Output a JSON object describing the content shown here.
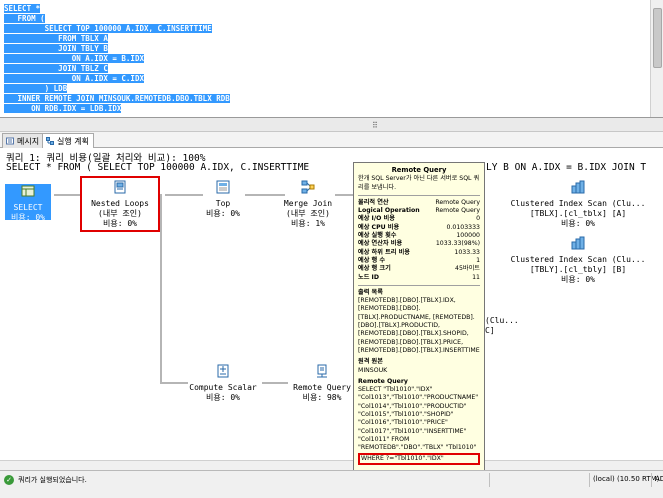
{
  "editor": {
    "lines": [
      "SELECT *",
      "   FROM (",
      "         SELECT TOP 100000 A.IDX, C.INSERTTIME",
      "            FROM TBLX A",
      "            JOIN TBLY B",
      "               ON A.IDX = B.IDX",
      "            JOIN TBLZ C",
      "               ON A.IDX = C.IDX",
      "         ) LDB",
      "   INNER REMOTE JOIN MINSOUK.REMOTEDB.DBO.TBLX RDB",
      "      ON RDB.IDX = LDB.IDX"
    ]
  },
  "splitter": {
    "grip": "⠿"
  },
  "tabs": [
    {
      "label": "메시지"
    },
    {
      "label": "실행 계획"
    }
  ],
  "plan": {
    "header_line1": "쿼리 1: 쿼리 비용(일괄 처리와 비교): 100%",
    "header_line2": "SELECT * FROM ( SELECT TOP 100000 A.IDX, C.INSERTTIME",
    "header_line2_tail": "LY B ON A.IDX = B.IDX JOIN T",
    "ops": {
      "select": {
        "name": "SELECT",
        "cost": "비용: 0%"
      },
      "nested": {
        "name": "Nested Loops",
        "sub": "(내부 조인)",
        "cost": "비용: 0%"
      },
      "top": {
        "name": "Top",
        "cost": "비용: 0%"
      },
      "merge": {
        "name": "Merge Join",
        "sub": "(내부 조인)",
        "cost": "비용: 1%"
      },
      "cis1": {
        "name": "Clustered Index Scan (Clu...",
        "obj": "[TBLX].[cl_tblx] [A]",
        "cost": "비용: 0%"
      },
      "cis2": {
        "name": "Clustered Index Scan (Clu...",
        "obj": "[TBLY].[cl_tbly] [B]",
        "cost": "비용: 0%"
      },
      "cis3_tail": "(Clu...",
      "cis3_tail2": "C]",
      "compute": {
        "name": "Compute Scalar",
        "cost": "비용: 0%"
      },
      "remote": {
        "name": "Remote Query",
        "cost": "비용: 98%"
      }
    }
  },
  "tooltip": {
    "title": "Remote Query",
    "desc": "한개 SQL Server가 아닌 다른 서버로 SQL 쿼리를 보냅니다.",
    "rows": [
      {
        "k": "물리적 연산",
        "v": "Remote Query",
        "bold": true
      },
      {
        "k": "Logical Operation",
        "v": "Remote Query",
        "bold": true
      },
      {
        "k": "예상 I/O 비용",
        "v": "0",
        "bold": true
      },
      {
        "k": "예상 CPU 비용",
        "v": "0.0103333",
        "bold": true
      },
      {
        "k": "예상 실행 횟수",
        "v": "100000",
        "bold": true
      },
      {
        "k": "예상 연산자 비용",
        "v": "1033.33(98%)",
        "bold": true
      },
      {
        "k": "예상 하위 트리 비용",
        "v": "1033.33",
        "bold": true
      },
      {
        "k": "예상 행 수",
        "v": "1",
        "bold": true
      },
      {
        "k": "예상 행 크기",
        "v": "45바이트",
        "bold": true
      },
      {
        "k": "노드 ID",
        "v": "11",
        "bold": true
      }
    ],
    "output_title": "출력 목록",
    "output_lines": [
      "[REMOTEDB].[DBO].[TBLX].IDX,",
      "[REMOTEDB].[DBO].",
      "[TBLX].PRODUCTNAME, [REMOTEDB].",
      "[DBO].[TBLX].PRODUCTID,",
      "[REMOTEDB].[DBO].[TBLX].SHOPID,",
      "[REMOTEDB].[DBO].[TBLX].PRICE,",
      "[REMOTEDB].[DBO].[TBLX].INSERTTIME"
    ],
    "source_title": "원격 원본",
    "source_value": "MINSOUK",
    "query_title": "Remote Query",
    "query_lines": [
      "SELECT \"Tbl1010\".\"IDX\"",
      "\"Col1013\",\"Tbl1010\".\"PRODUCTNAME\"",
      "\"Col1014\",\"Tbl1010\".\"PRODUCTID\"",
      "\"Col1015\",\"Tbl1010\".\"SHOPID\"",
      "\"Col1016\",\"Tbl1010\".\"PRICE\"",
      "\"Col1017\",\"Tbl1010\".\"INSERTTIME\"",
      "\"Col1011\" FROM",
      "\"REMOTEDB\".\"DBO\".\"TBLX\" \"Tbl1010\""
    ],
    "query_where": "WHERE ?=\"Tbl1010\".\"IDX\""
  },
  "status": {
    "message": "쿼리가 실행되었습니다.",
    "server": "(local) (10.50 RTM)",
    "tail": "AD"
  },
  "colors": {
    "selection": "#3399ff",
    "highlight_red": "#e00000",
    "tooltip_bg": "#ffffe1"
  }
}
